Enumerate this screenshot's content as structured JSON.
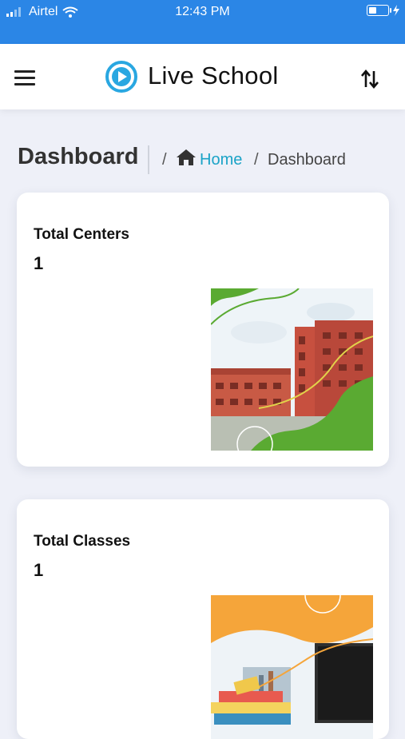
{
  "status_bar": {
    "carrier": "Airtel",
    "time": "12:43 PM",
    "icons": [
      "signal-icon",
      "wifi-icon",
      "battery-icon",
      "charging-icon"
    ]
  },
  "app_bar": {
    "title": "Live School",
    "icons": [
      "hamburger-menu-icon",
      "live-school-logo",
      "sort-icon"
    ]
  },
  "header": {
    "page_title": "Dashboard",
    "breadcrumb": {
      "separator": "/",
      "home_label": "Home",
      "current_label": "Dashboard",
      "home_icon": "home-icon"
    }
  },
  "cards": [
    {
      "label": "Total Centers",
      "value": "1",
      "image": "school-building-illustration"
    },
    {
      "label": "Total Classes",
      "value": "1",
      "image": "classroom-books-illustration"
    }
  ],
  "colors": {
    "status_bar": "#2b86e6",
    "accent": "#1aa3c7",
    "logo": "#29a7e1",
    "card_green": "#5aaa32",
    "card_orange": "#f5a53a",
    "background": "#eef0f8"
  }
}
